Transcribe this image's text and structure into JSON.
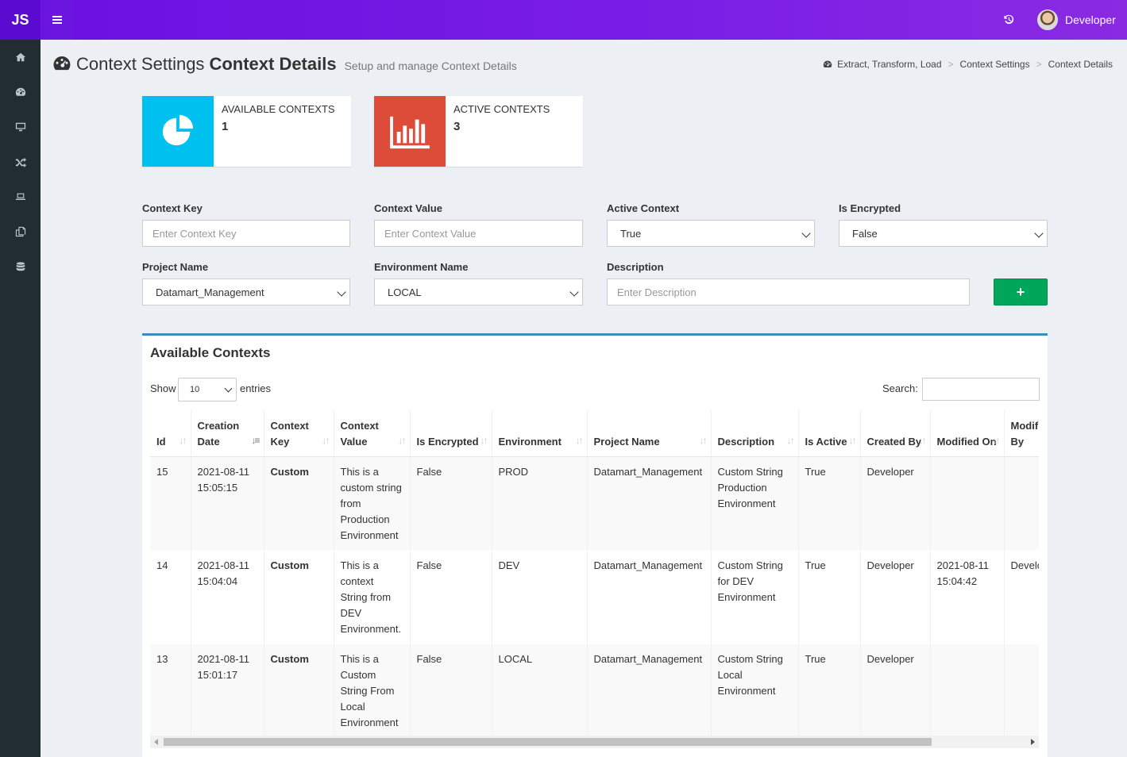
{
  "app": {
    "logo": "JS",
    "user_name": "Developer"
  },
  "header": {
    "title_light": "Context Settings",
    "title_bold": "Context Details",
    "subtitle": "Setup and manage Context Details"
  },
  "breadcrumb": [
    "Extract, Transform, Load",
    "Context Settings",
    "Context Details"
  ],
  "sidebar": {
    "items": [
      {
        "icon": "home-icon"
      },
      {
        "icon": "dashboard-icon"
      },
      {
        "icon": "desktop-icon"
      },
      {
        "icon": "random-icon"
      },
      {
        "icon": "laptop-icon"
      },
      {
        "icon": "copy-icon"
      },
      {
        "icon": "database-icon"
      }
    ]
  },
  "stats": {
    "available": {
      "label": "AVAILABLE CONTEXTS",
      "value": "1",
      "color": "#00c0ef"
    },
    "active": {
      "label": "ACTIVE CONTEXTS",
      "value": "3",
      "color": "#dd4b39"
    }
  },
  "form": {
    "context_key": {
      "label": "Context Key",
      "placeholder": "Enter Context Key"
    },
    "context_value": {
      "label": "Context Value",
      "placeholder": "Enter Context Value"
    },
    "active_context": {
      "label": "Active Context",
      "value": "True"
    },
    "is_encrypted": {
      "label": "Is Encrypted",
      "value": "False"
    },
    "project_name": {
      "label": "Project Name",
      "value": "Datamart_Management"
    },
    "environment_name": {
      "label": "Environment Name",
      "value": "LOCAL"
    },
    "description": {
      "label": "Description",
      "placeholder": "Enter Description"
    },
    "add_label": "+"
  },
  "table": {
    "title": "Available Contexts",
    "show_label": "Show",
    "page_length": "10",
    "entries_label": "entries",
    "search_label": "Search:",
    "columns": [
      "Id",
      "Creation Date",
      "Context Key",
      "Context Value",
      "Is Encrypted",
      "Environment",
      "Project Name",
      "Description",
      "Is Active",
      "Created By",
      "Modified On",
      "Modified By"
    ],
    "rows": [
      {
        "id": "15",
        "creation_date": "2021-08-11 15:05:15",
        "context_key": "Custom",
        "context_value": "This is a custom string from Production Environment",
        "is_encrypted": "False",
        "environment": "PROD",
        "project_name": "Datamart_Management",
        "description": "Custom String Production Environment",
        "is_active": "True",
        "created_by": "Developer",
        "modified_on": "",
        "modified_by": ""
      },
      {
        "id": "14",
        "creation_date": "2021-08-11 15:04:04",
        "context_key": "Custom",
        "context_value": "This is a context String from DEV Environment.",
        "is_encrypted": "False",
        "environment": "DEV",
        "project_name": "Datamart_Management",
        "description": "Custom String for DEV Environment",
        "is_active": "True",
        "created_by": "Developer",
        "modified_on": "2021-08-11 15:04:42",
        "modified_by": "Developer"
      },
      {
        "id": "13",
        "creation_date": "2021-08-11 15:01:17",
        "context_key": "Custom",
        "context_value": "This is a Custom String From Local Environment",
        "is_encrypted": "False",
        "environment": "LOCAL",
        "project_name": "Datamart_Management",
        "description": "Custom String Local Environment",
        "is_active": "True",
        "created_by": "Developer",
        "modified_on": "",
        "modified_by": ""
      }
    ]
  }
}
